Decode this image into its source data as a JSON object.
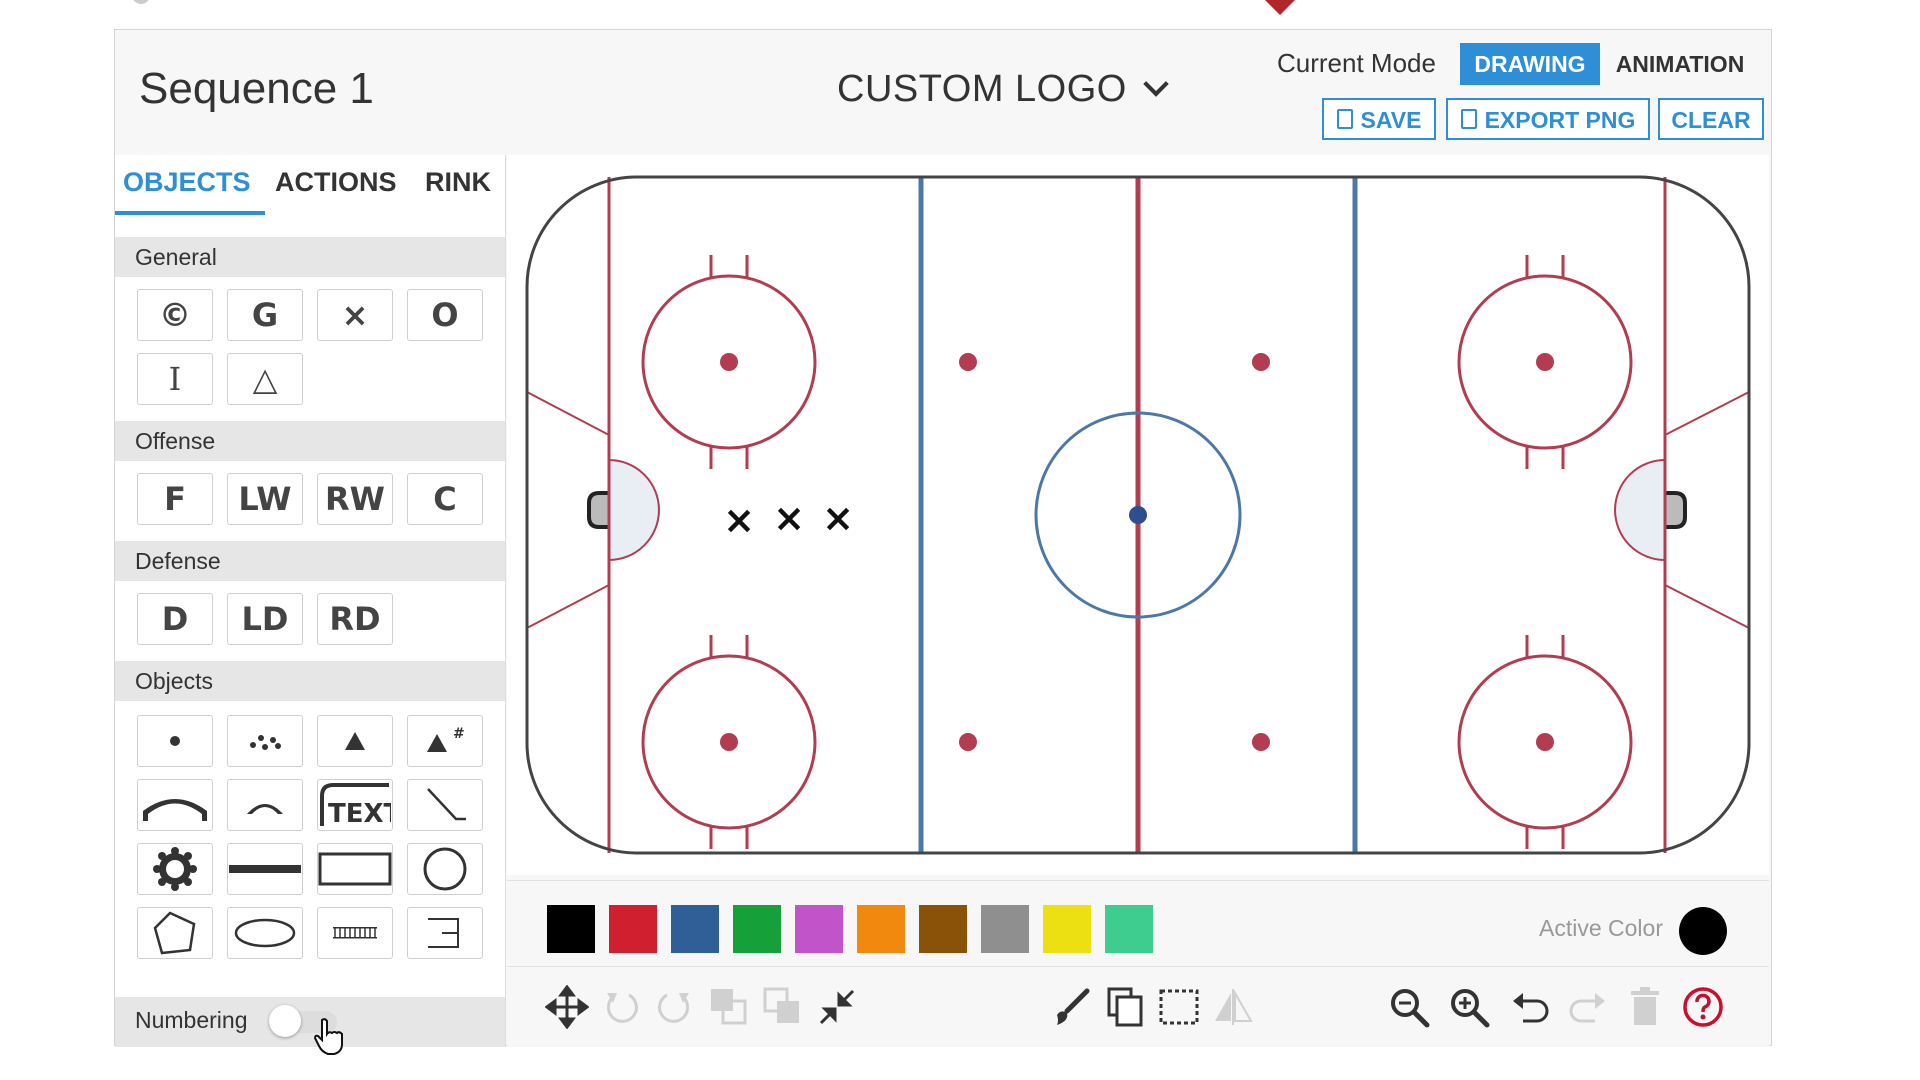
{
  "header": {
    "sequence_title": "Sequence 1",
    "logo_select": "CUSTOM LOGO",
    "mode_label": "Current Mode",
    "mode_drawing": "DRAWING",
    "mode_animation": "ANIMATION",
    "save_label": "SAVE",
    "export_label": "EXPORT PNG",
    "clear_label": "CLEAR",
    "active_mode": "DRAWING"
  },
  "tabs": [
    "OBJECTS",
    "ACTIONS",
    "RINK"
  ],
  "sections": {
    "general": "General",
    "offense": "Offense",
    "defense": "Defense",
    "objects": "Objects"
  },
  "general_tools": [
    "©",
    "G",
    "×",
    "O",
    "I",
    "△"
  ],
  "offense_tools": [
    "F",
    "LW",
    "RW",
    "C"
  ],
  "defense_tools": [
    "D",
    "LD",
    "RD"
  ],
  "object_tools": {
    "text_label": "TEXT",
    "number_marker": "#"
  },
  "numbering": {
    "label": "Numbering",
    "enabled": false
  },
  "palette": {
    "colors": [
      "#000000",
      "#d0202f",
      "#2f5f96",
      "#16a03a",
      "#c054c8",
      "#f0890e",
      "#8a5208",
      "#8f8f8f",
      "#ece013",
      "#3fcd8f"
    ],
    "active_label": "Active Color",
    "active_color": "#000000"
  },
  "toolbar_icons": [
    "move-icon",
    "rotate-left-icon",
    "rotate-right-icon",
    "send-backward-icon",
    "bring-forward-icon",
    "shrink-icon",
    "brush-icon",
    "copy-icon",
    "select-icon",
    "flip-icon",
    "zoom-out-icon",
    "zoom-in-icon",
    "undo-icon",
    "redo-icon",
    "trash-icon",
    "help-icon"
  ],
  "rink": {
    "boards_color": "#444444",
    "red_line_color": "#b23c50",
    "blue_line_color": "#4c78a8",
    "crease_color": "#e8eef3",
    "player_markers": [
      "×",
      "×",
      "×"
    ]
  }
}
